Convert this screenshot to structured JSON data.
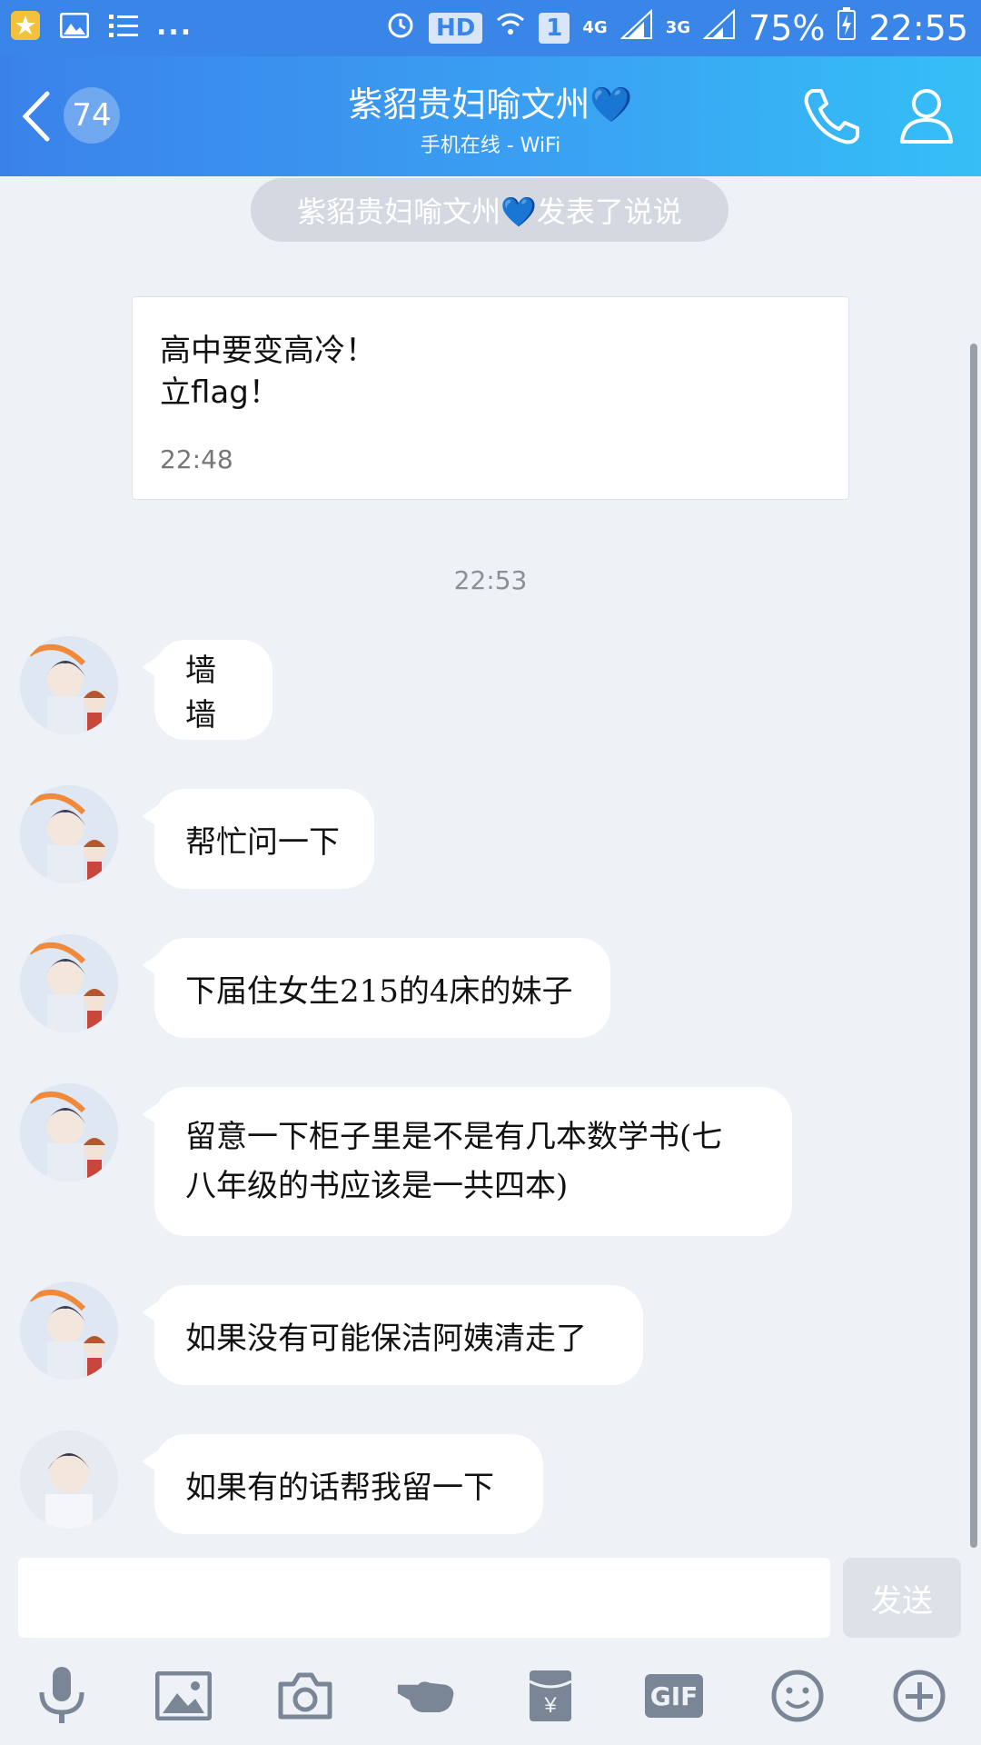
{
  "status_bar": {
    "network_4g": "4G",
    "network_3g": "3G",
    "hd": "HD",
    "sim": "1",
    "battery": "75%",
    "time": "22:55"
  },
  "header": {
    "back_count": "74",
    "title": "紫貂贵妇喻文州",
    "title_emoji": "💙",
    "subtitle": "手机在线 - WiFi"
  },
  "system_notice": "紫貂贵妇喻文州💙发表了说说",
  "post": {
    "line1": "高中要变高冷！",
    "line2": "立flag！",
    "time": "22:48"
  },
  "separator_time": "22:53",
  "messages": [
    {
      "text": "墙墙"
    },
    {
      "text": "帮忙问一下"
    },
    {
      "text": "下届住女生215的4床的妹子"
    },
    {
      "text_line1": "留意一下柜子里是不是有几本数学书(七",
      "text_line2": "八年级的书应该是一共四本)"
    },
    {
      "text": "如果没有可能保洁阿姨清走了"
    },
    {
      "text": "如果有的话帮我留一下"
    }
  ],
  "input": {
    "placeholder": "",
    "send_label": "发送"
  },
  "toolbar": {
    "gif_label": "GIF"
  },
  "colors": {
    "accent": "#3a86e8",
    "background": "#eef1f6"
  }
}
